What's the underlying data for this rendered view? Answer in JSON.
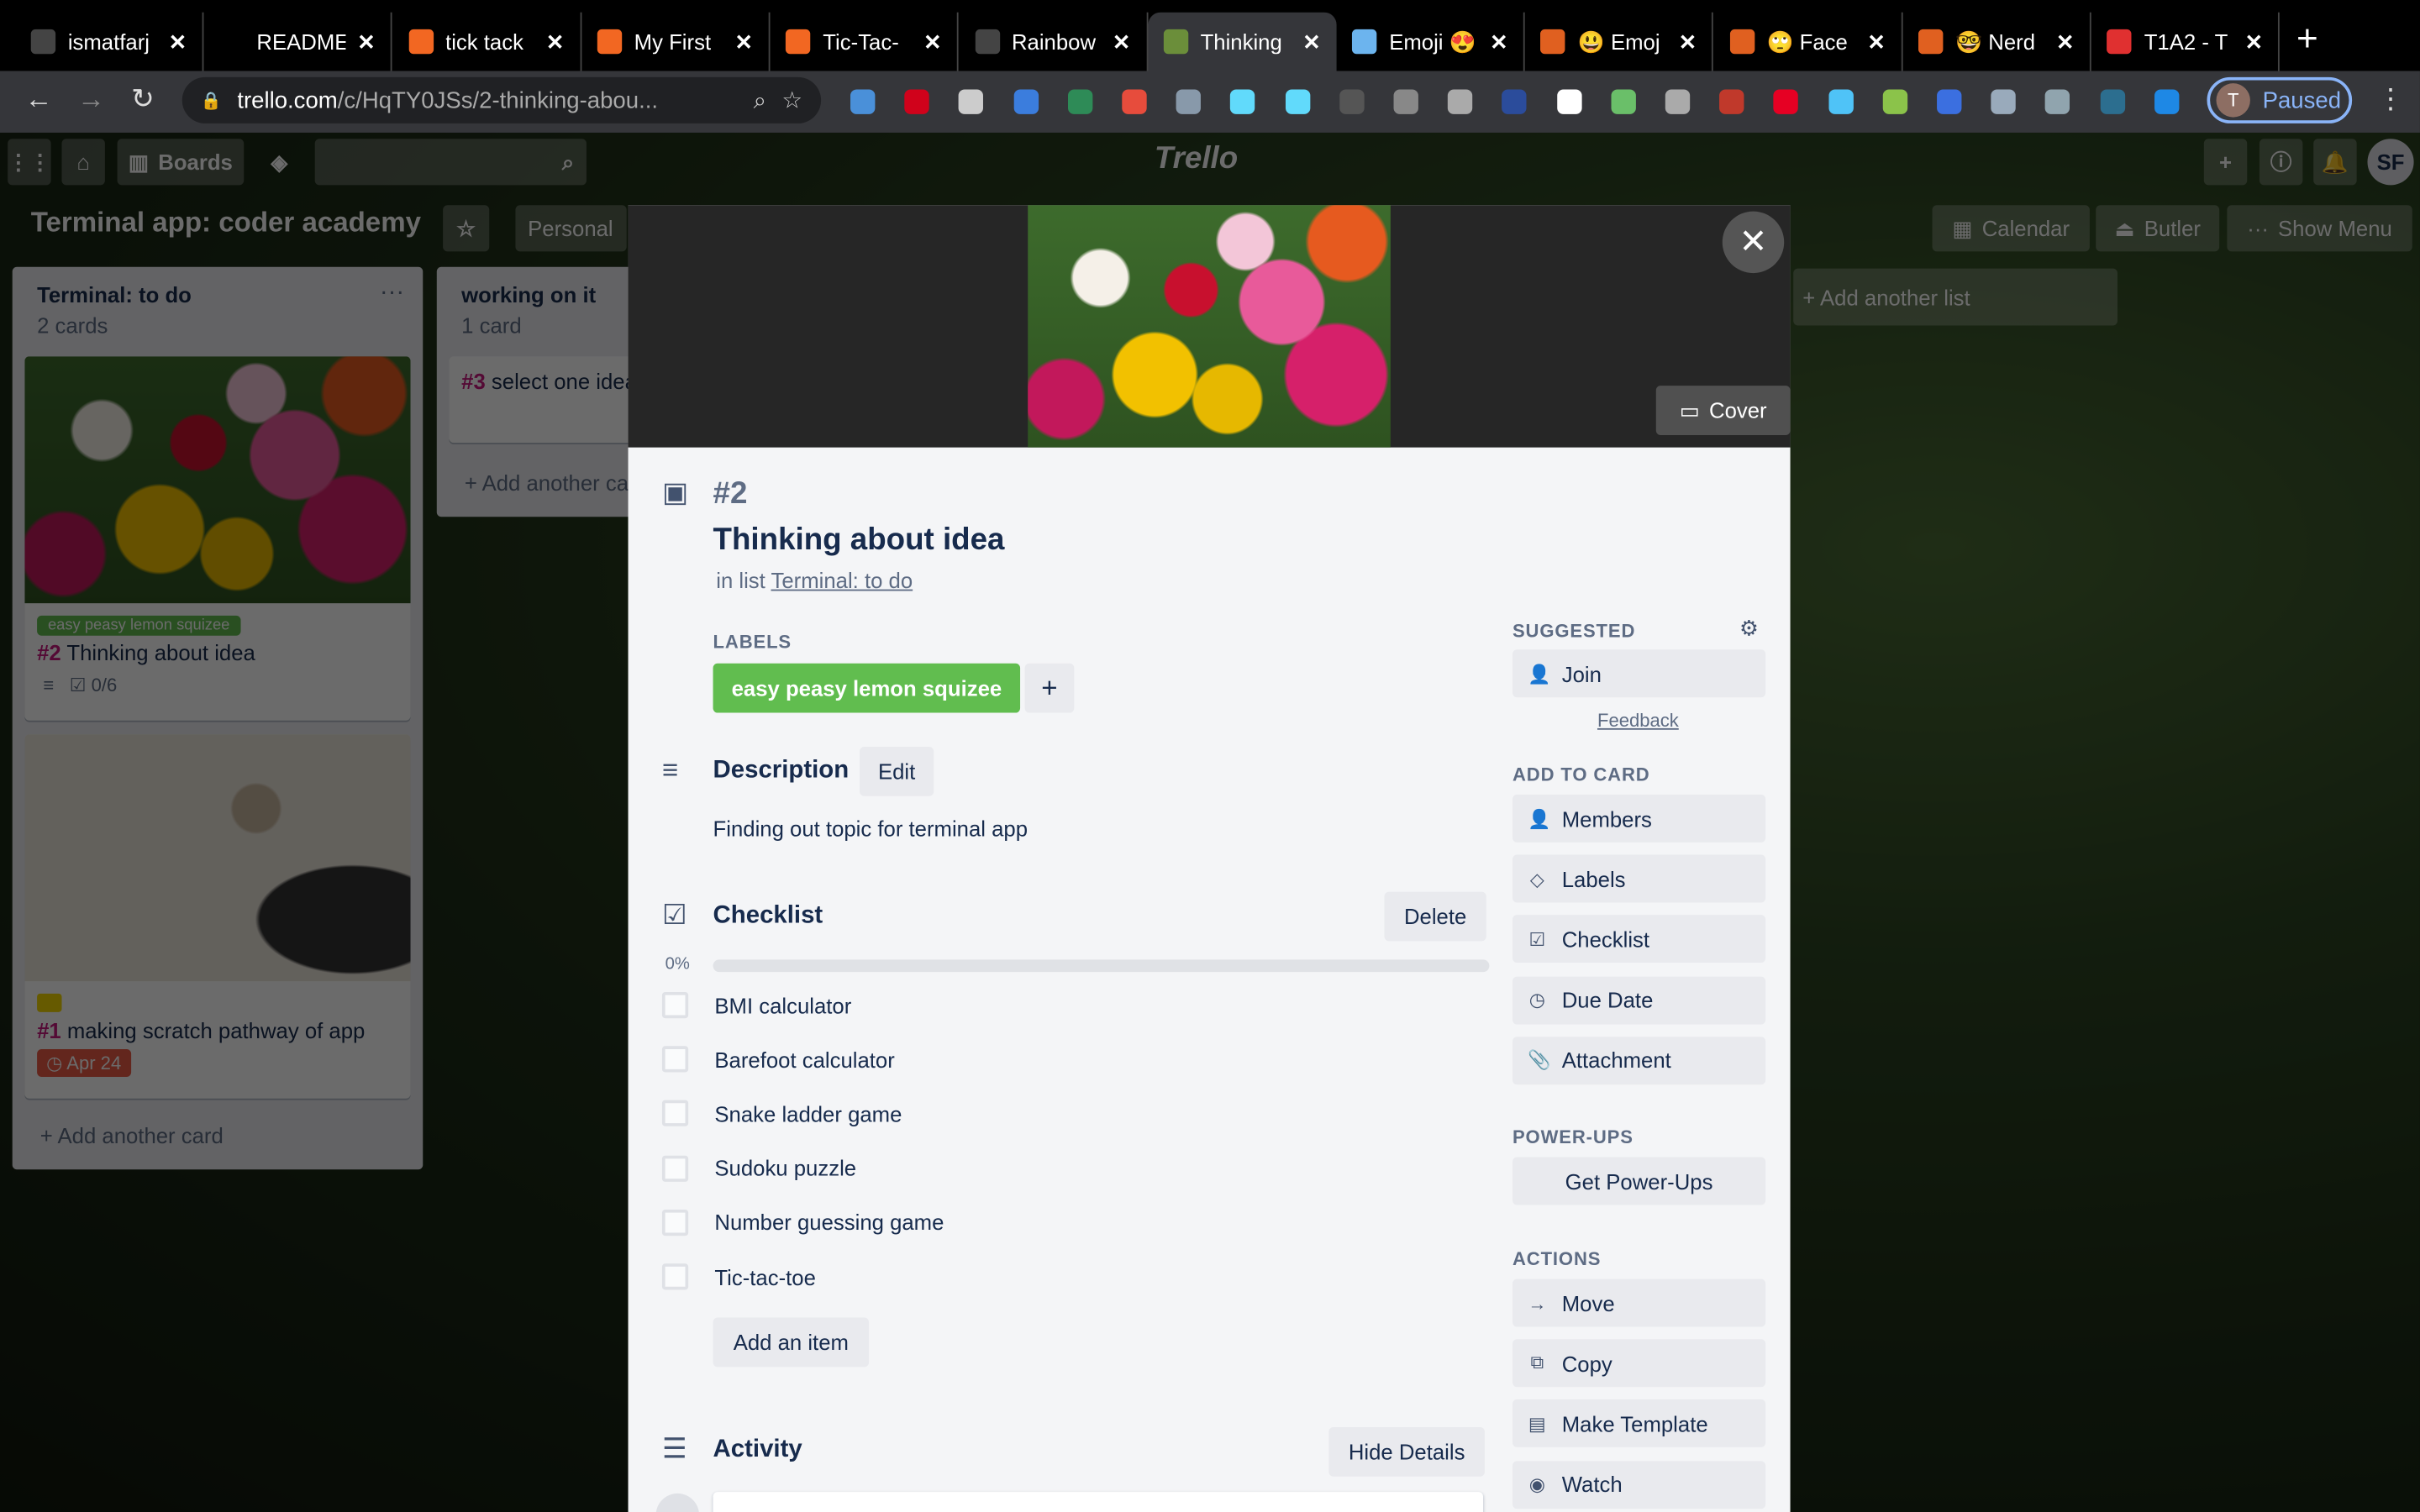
{
  "browser": {
    "tabs": [
      {
        "label": "ismatfarj",
        "favicon": "github-icon",
        "color": "#444"
      },
      {
        "label": "README",
        "favicon": "none",
        "color": "transparent"
      },
      {
        "label": "tick tack",
        "favicon": "gitbook-icon",
        "color": "#f26722"
      },
      {
        "label": "My First",
        "favicon": "gitbook-icon",
        "color": "#f26722"
      },
      {
        "label": "Tic-Tac-",
        "favicon": "gitbook-icon",
        "color": "#f26722"
      },
      {
        "label": "Rainbow",
        "favicon": "github-icon",
        "color": "#444"
      },
      {
        "label": "Thinking",
        "favicon": "trello-icon",
        "color": "#6b8e3a",
        "active": true
      },
      {
        "label": "Emoji 😍",
        "favicon": "heart-icon",
        "color": "#6cb4ee"
      },
      {
        "label": "😃 Emoj",
        "favicon": "emoji-book-icon",
        "color": "#e06020"
      },
      {
        "label": "🙄 Face",
        "favicon": "emoji-book-icon",
        "color": "#e06020"
      },
      {
        "label": "🤓 Nerd",
        "favicon": "emoji-book-icon",
        "color": "#e06020"
      },
      {
        "label": "T1A2 - T",
        "favicon": "canvas-icon",
        "color": "#e03030"
      }
    ],
    "new_tab": "+",
    "url_host": "trello.com",
    "url_path": "/c/HqTY0JSs/2-thinking-abou...",
    "extensions": [
      "#4a90d9",
      "#d0021b",
      "#cccccc",
      "#3b7ddd",
      "#2e8b57",
      "#e74c3c",
      "#8899aa",
      "#61dafb",
      "#61dafb",
      "#555555",
      "#888888",
      "#aaaaaa",
      "#2b4c9b",
      "#ffffff",
      "#6abf69",
      "#aaaaaa",
      "#c0392b",
      "#e60023",
      "#4fc3f7",
      "#8bc34a",
      "#3b6fe0",
      "#99aabb",
      "#90a4ae",
      "#2c6e8f",
      "#1e88e5"
    ],
    "profile_initial": "T",
    "profile_status": "Paused"
  },
  "trello": {
    "boards_label": "Boards",
    "logo": "Trello",
    "avatar": "SF",
    "board_title": "Terminal app: coder academy",
    "visibility": "Personal",
    "calendar": "Calendar",
    "butler": "Butler",
    "show_menu": "Show Menu",
    "add_list": "+ Add another list",
    "lists": [
      {
        "title": "Terminal: to do",
        "count": "2 cards",
        "cards": [
          {
            "label": "easy peasy lemon squizee",
            "num": "#2",
            "title": "Thinking about idea",
            "checklist": "0/6"
          },
          {
            "num": "#1",
            "title": "making scratch pathway of app",
            "due": "Apr 24"
          }
        ],
        "add": "+ Add another card"
      },
      {
        "title": "working on it",
        "count": "1 card",
        "cards": [
          {
            "num": "#3",
            "title": "select one idea"
          }
        ],
        "add": "+ Add another card"
      }
    ]
  },
  "modal": {
    "cover_button": "Cover",
    "number": "#2",
    "title": "Thinking about idea",
    "in_list_prefix": "in list",
    "in_list": "Terminal: to do",
    "labels_heading": "LABELS",
    "label": "easy peasy lemon squizee",
    "label_color": "#61bd4f",
    "description_heading": "Description",
    "edit": "Edit",
    "description": "Finding out topic for terminal app",
    "checklist_heading": "Checklist",
    "delete": "Delete",
    "progress_percent": 0,
    "progress_label": "0%",
    "items": [
      "BMI calculator",
      "Barefoot calculator",
      "Snake ladder game",
      "Sudoku puzzle",
      "Number guessing game",
      "Tic-tac-toe"
    ],
    "add_item": "Add an item",
    "activity_heading": "Activity",
    "hide_details": "Hide Details",
    "sidebar": {
      "suggested": "SUGGESTED",
      "join": "Join",
      "feedback": "Feedback",
      "add_to_card": "ADD TO CARD",
      "add_items": [
        "Members",
        "Labels",
        "Checklist",
        "Due Date",
        "Attachment"
      ],
      "power_ups": "POWER-UPS",
      "get_power_ups": "Get Power-Ups",
      "actions": "ACTIONS",
      "action_items": [
        "Move",
        "Copy",
        "Make Template",
        "Watch"
      ]
    }
  }
}
